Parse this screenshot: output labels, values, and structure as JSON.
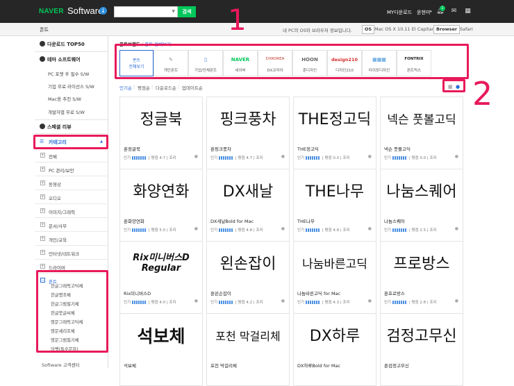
{
  "header": {
    "brand": "NAVER",
    "product": "Software",
    "download_icon": "download-circle-icon",
    "search_placeholder": "",
    "search_button": "검색",
    "my_download": "MY다운로드",
    "user_name": "윤현미",
    "notify_count": "1"
  },
  "subbar": {
    "section": "폰트",
    "notice": "내 PC의 OS와 브라우저 정보입니다.",
    "os_label": "OS",
    "os_value": "Mac OS X 10.11 El Capitan",
    "browser_label": "Browser",
    "browser_value": "Safari"
  },
  "sidebar": {
    "main": [
      {
        "label": "다운로드 TOP50",
        "icon": "download-icon"
      },
      {
        "label": "테마 소프트웨어",
        "icon": "theme-icon"
      }
    ],
    "theme_items": [
      "PC 포맷 후 필수 S/W",
      "기업 무료 라이선스 S/W",
      "Mac용 추천 S/W",
      "개발자별 무료 S/W"
    ],
    "review": {
      "label": "스페셜 리뷰",
      "icon": "review-icon"
    },
    "category": {
      "label": "카테고리",
      "icon": "list-icon"
    },
    "categories": [
      "전체",
      "PC 관리/보안",
      "동영상",
      "오디오",
      "이미지/그래픽",
      "문서/사무",
      "개인/교육",
      "인터넷/네트워크",
      "드라이버"
    ],
    "font_category": "폰트",
    "font_items": [
      "한글그래픽고딕체",
      "한글명조체",
      "한글그림필기체",
      "한글붓글씨체",
      "영문그래픽고딕체",
      "영문세리프체",
      "영문그림필기체",
      "딩벳(특수문자)"
    ],
    "footer": "Software 고객센터"
  },
  "breadcrumb": {
    "current": "폰트브랜드",
    "separator": "|",
    "link": "폰트 전체보기"
  },
  "brand_tabs": [
    {
      "label": "폰트\n전체보기",
      "active": true
    },
    {
      "label": "개인폰트",
      "logo": "✎"
    },
    {
      "label": "기업/단체폰트",
      "logo": "▯"
    },
    {
      "label": "네이버",
      "logo": "NAVER"
    },
    {
      "label": "DX코리아",
      "logo": "DXKOREA"
    },
    {
      "label": "훈디자인",
      "logo": "HOON"
    },
    {
      "label": "디자인210",
      "logo": "design210"
    },
    {
      "label": "타이포디자인",
      "logo": "▦▦▦"
    },
    {
      "label": "폰트릭스",
      "logo": "FONTRIX"
    }
  ],
  "sort_options": [
    "인기순",
    "평점순",
    "다운로드순",
    "업데이트순"
  ],
  "annotations": [
    "1",
    "2"
  ],
  "cards": [
    {
      "preview": "정글북",
      "name": "훈정글북",
      "popularity": "인기",
      "rating": "평점 4.7",
      "license": "프리"
    },
    {
      "preview": "핑크풍차",
      "name": "훈핑크풍차",
      "popularity": "인기",
      "rating": "평점 4.7",
      "license": "프리"
    },
    {
      "preview": "THE정고딕",
      "name": "THE정고딕",
      "popularity": "인기",
      "rating": "평점 0.0",
      "license": "프리"
    },
    {
      "preview": "넥슨 풋볼고딕",
      "name": "넥슨 풋볼고딕",
      "popularity": "인기",
      "rating": "평점 0.0",
      "license": "프리"
    },
    {
      "preview": "화양연화",
      "name": "훈화양연화",
      "popularity": "인기",
      "rating": "평점 5.0",
      "license": "프리"
    },
    {
      "preview": "DX새날",
      "name": "DX새날Bold for Mac",
      "popularity": "인기",
      "rating": "평점 4.8",
      "license": "프리"
    },
    {
      "preview": "THE나무",
      "name": "THE나무",
      "popularity": "인기",
      "rating": "평점 4.8",
      "license": "프리"
    },
    {
      "preview": "나눔스퀘어",
      "name": "나눔스퀘어",
      "popularity": "인기",
      "rating": "평점 2.5",
      "license": "프리"
    },
    {
      "preview": "Rix미니버스D Regular",
      "name": "Rix미니버스D",
      "popularity": "인기",
      "rating": "평점 4.0",
      "license": "프리"
    },
    {
      "preview": "왼손잡이",
      "name": "훈왼손잡이",
      "popularity": "인기",
      "rating": "평점 4.2",
      "license": "프리"
    },
    {
      "preview": "나눔바른고딕",
      "name": "나눔바른고딕 for Mac",
      "popularity": "인기",
      "rating": "평점 4.3",
      "license": "프리"
    },
    {
      "preview": "프로방스",
      "name": "훈프로방스",
      "popularity": "인기",
      "rating": "평점 2.8",
      "license": "프리"
    },
    {
      "preview": "석보체",
      "name": "석보체",
      "popularity": "",
      "rating": "",
      "license": ""
    },
    {
      "preview": "포천 막걸리체",
      "name": "포천 막걸리체",
      "popularity": "",
      "rating": "",
      "license": ""
    },
    {
      "preview": "DX하루",
      "name": "DX하루Bold for Mac",
      "popularity": "",
      "rating": "",
      "license": ""
    },
    {
      "preview": "검정고무신",
      "name": "훈검정고무신",
      "popularity": "",
      "rating": "",
      "license": ""
    }
  ],
  "colors": {
    "accent": "#2a6bd8",
    "brand_green": "#03c75a",
    "annotation": "#e8195a"
  }
}
